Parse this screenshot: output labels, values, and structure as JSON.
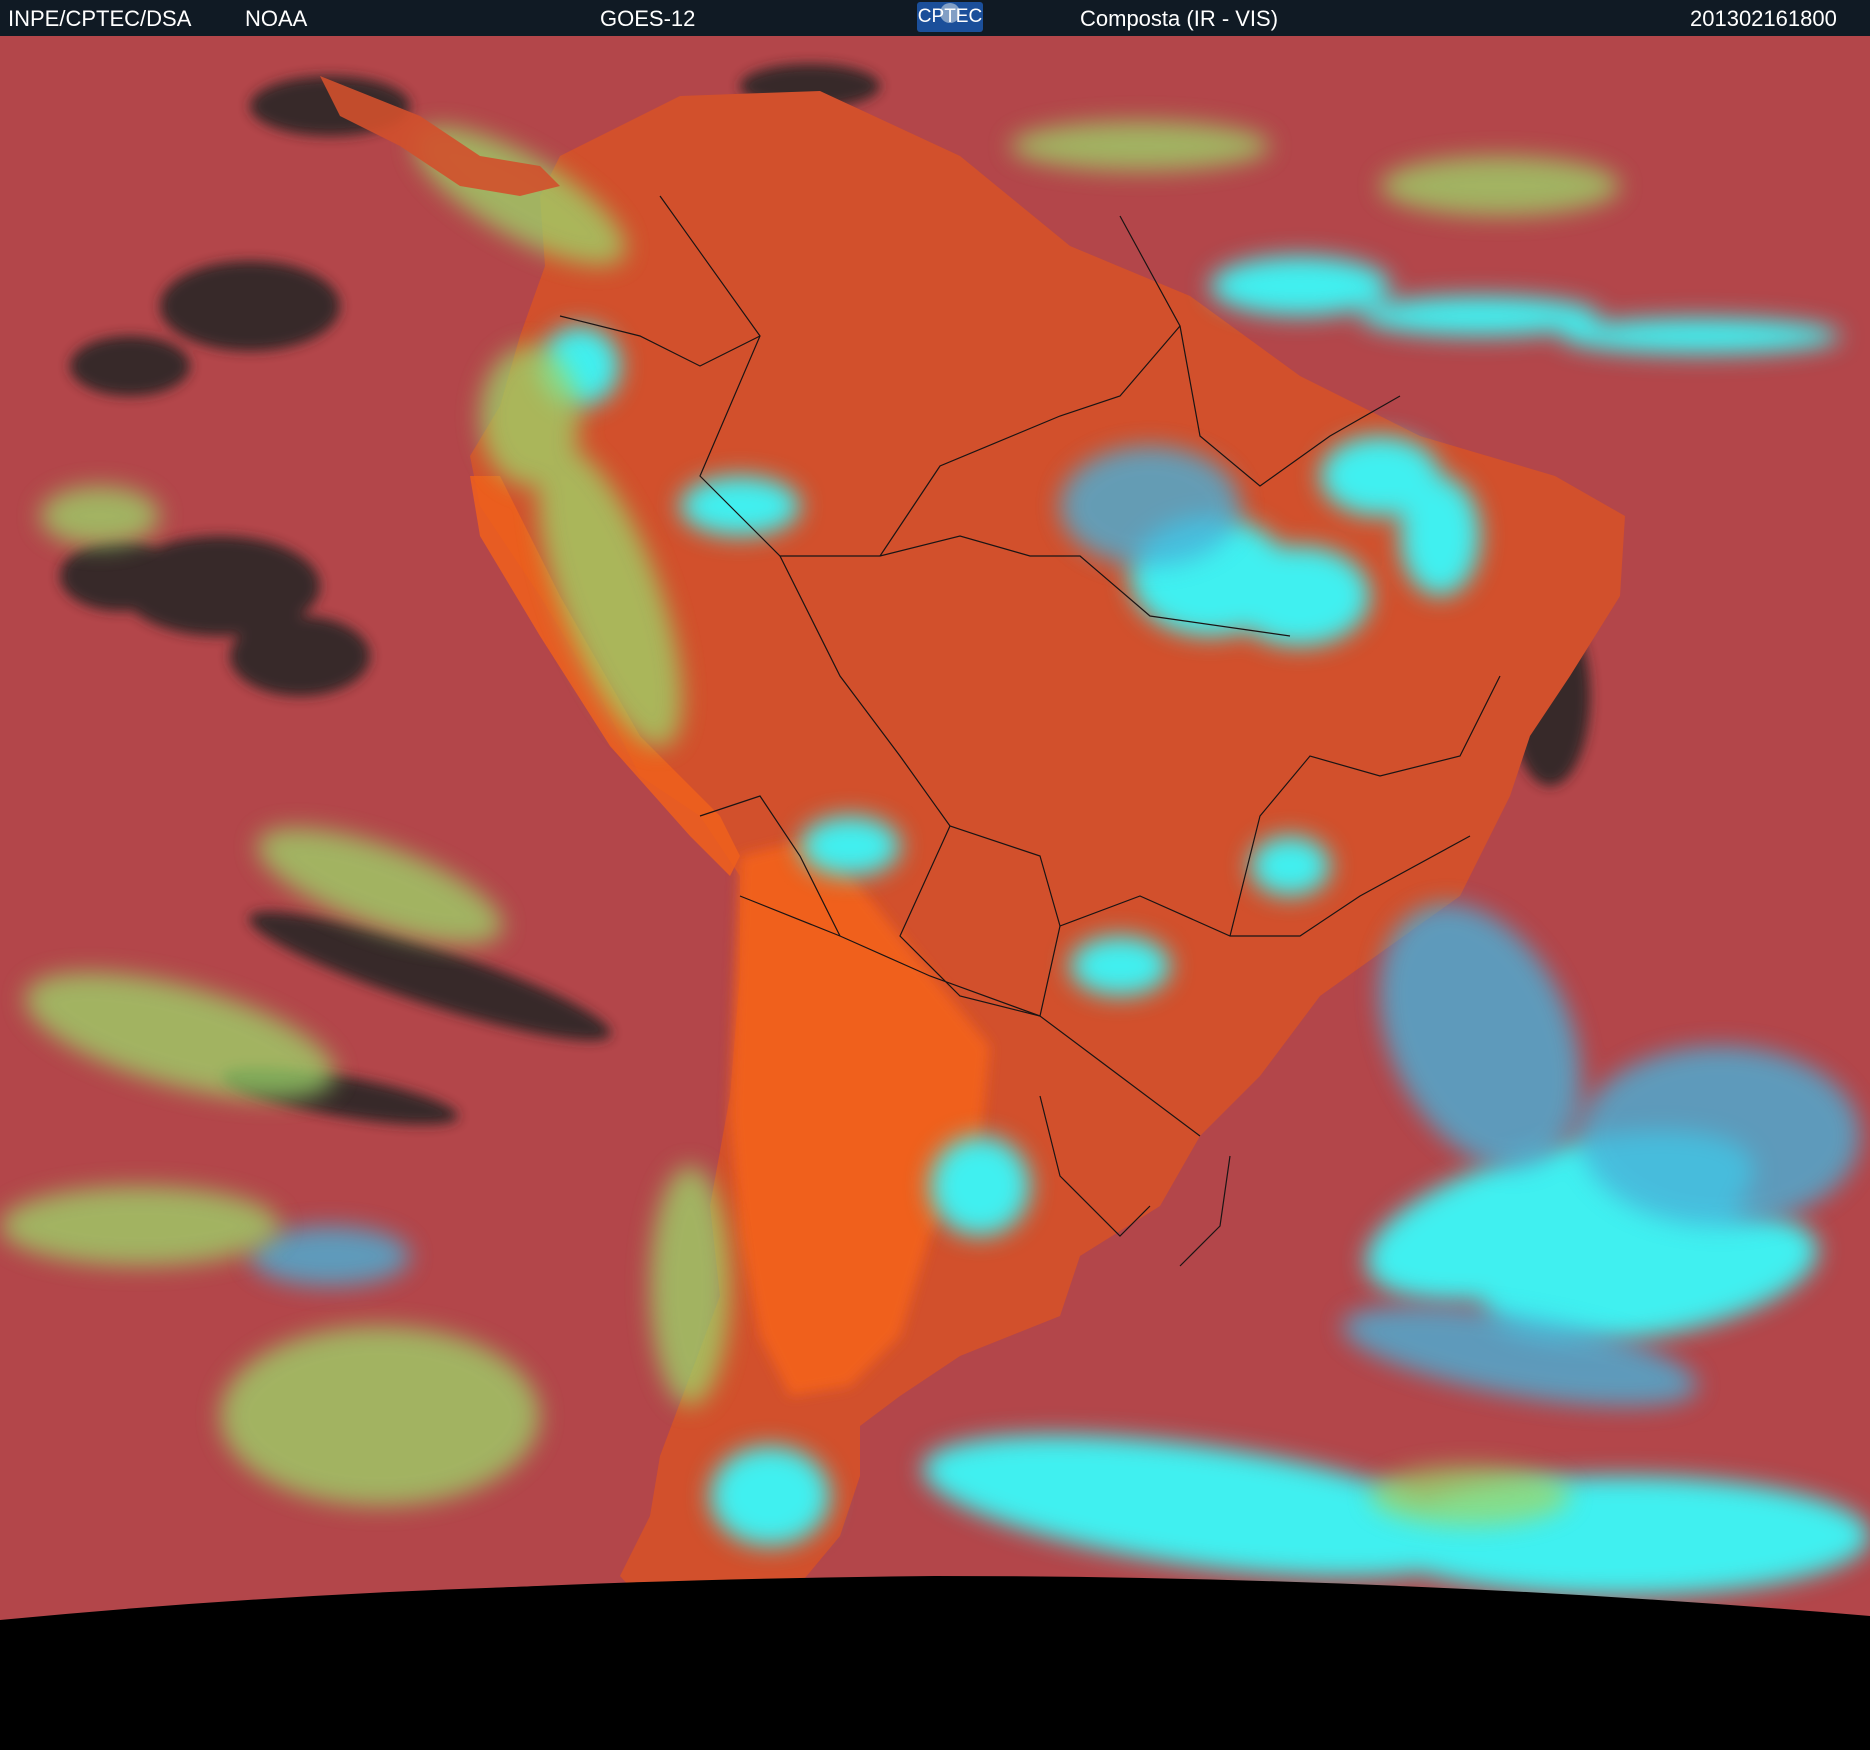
{
  "header": {
    "agency": "INPE/CPTEC/DSA",
    "source": "NOAA",
    "satellite": "GOES-12",
    "logo_text": "CPTEC",
    "product": "Composta (IR - VIS)",
    "timestamp": "201302161800"
  },
  "colors": {
    "ocean": "#b3464a",
    "land": "#d2502c",
    "desert": "#f0601c",
    "high_cloud": "#3ff0f0",
    "mid_cloud": "#4ab0d8",
    "low_cloud": "#9cd86a",
    "clear_dark": "#2a2626",
    "header_bg": "#101a24",
    "border_lines": "#1a1414"
  }
}
